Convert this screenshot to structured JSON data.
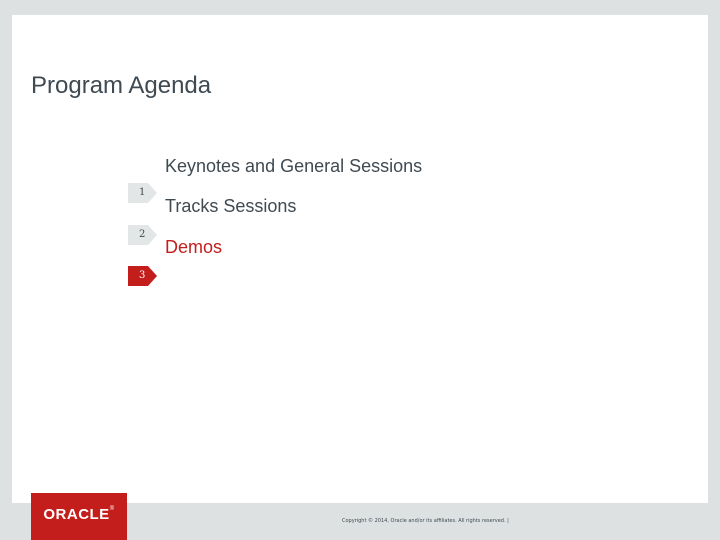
{
  "slide": {
    "title": "Program Agenda",
    "items": [
      {
        "label": "Keynotes and General Sessions",
        "number": "1"
      },
      {
        "label": "Tracks Sessions",
        "number": "2"
      },
      {
        "label": "Demos",
        "number": "3"
      }
    ],
    "active_item": "3"
  },
  "footer": {
    "logo_text": "ORACLE",
    "logo_mark": "®",
    "copyright": "Copyright © 2014, Oracle and/or its affiliates. All rights reserved.  |"
  },
  "colors": {
    "brand_red": "#c41e1c",
    "text": "#3f4a52",
    "background": "#dde1e2",
    "marker_inactive": "#e3e6e7"
  }
}
